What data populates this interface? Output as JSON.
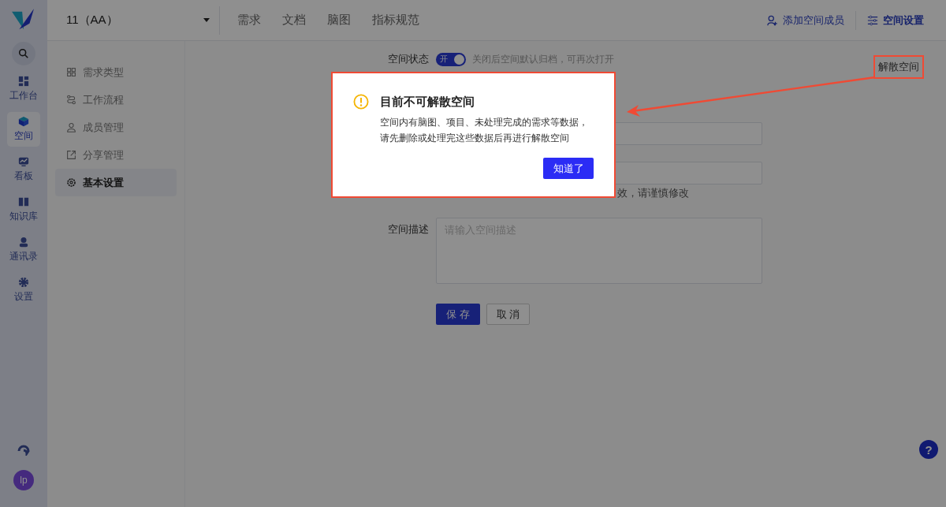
{
  "rail": {
    "items": [
      {
        "label": "工作台",
        "kind": "dashboard",
        "selected": false
      },
      {
        "label": "空间",
        "kind": "cube",
        "selected": true
      },
      {
        "label": "看板",
        "kind": "board",
        "selected": false
      },
      {
        "label": "知识库",
        "kind": "book",
        "selected": false
      },
      {
        "label": "通讯录",
        "kind": "person",
        "selected": false
      },
      {
        "label": "设置",
        "kind": "gear",
        "selected": false
      }
    ],
    "avatar": "lp"
  },
  "header": {
    "space_name": "11（AA）",
    "tabs": [
      {
        "label": "需求",
        "selected": false
      },
      {
        "label": "文档",
        "selected": false
      },
      {
        "label": "脑图",
        "selected": false
      },
      {
        "label": "指标规范",
        "selected": false
      }
    ],
    "actions": [
      {
        "label": "添加空间成员",
        "kind": "add-member",
        "selected": false
      },
      {
        "label": "空间设置",
        "kind": "settings",
        "selected": true
      }
    ]
  },
  "settings_menu": [
    {
      "label": "需求类型",
      "kind": "grid",
      "selected": false
    },
    {
      "label": "工作流程",
      "kind": "flow",
      "selected": false
    },
    {
      "label": "成员管理",
      "kind": "user",
      "selected": false
    },
    {
      "label": "分享管理",
      "kind": "share",
      "selected": false
    },
    {
      "label": "基本设置",
      "kind": "gear",
      "selected": true
    }
  ],
  "form": {
    "status": {
      "label": "空间状态",
      "on": true,
      "toggle_text": "开",
      "hint": "关闭后空间默认归档，可再次打开"
    },
    "fields": [
      {
        "kind": "input"
      },
      {
        "kind": "input",
        "hint": "效，请谨慎修改"
      },
      {
        "kind": "textarea",
        "label": "空间描述",
        "placeholder": "请输入空间描述"
      }
    ],
    "save": "保 存",
    "cancel": "取 消"
  },
  "dissolve": "解散空间",
  "dialog": {
    "title": "目前不可解散空间",
    "lines": [
      "空间内有脑图、项目、未处理完成的需求等数据，",
      "请先删除或处理完这些数据后再进行解散空间"
    ],
    "button": "知道了"
  },
  "help": "?"
}
